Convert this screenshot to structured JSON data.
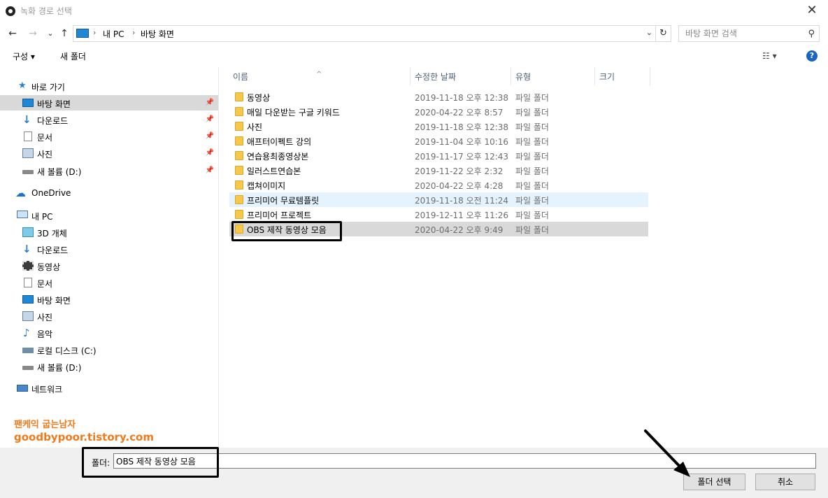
{
  "window": {
    "title": "녹화 경로 선택",
    "close_glyph": "✕"
  },
  "nav": {
    "back": "←",
    "forward": "→",
    "recent": "⌄",
    "up": "↑",
    "breadcrumb": [
      "내 PC",
      "바탕 화면"
    ],
    "refresh": "↻",
    "search_placeholder": "바탕 화면 검색"
  },
  "toolbar": {
    "organize": "구성 ▾",
    "new_folder": "새 폴더",
    "help": "?"
  },
  "sidebar": {
    "items": [
      {
        "label": "바로 가기",
        "icon": "star-icon"
      },
      {
        "label": "바탕 화면",
        "icon": "desktop-icon",
        "pinned": true,
        "selected": true
      },
      {
        "label": "다운로드",
        "icon": "download-icon",
        "pinned": true
      },
      {
        "label": "문서",
        "icon": "document-icon",
        "pinned": true
      },
      {
        "label": "사진",
        "icon": "pictures-icon",
        "pinned": true
      },
      {
        "label": "새 볼륨 (D:)",
        "icon": "drive-icon",
        "pinned": true
      },
      {
        "label": "OneDrive",
        "icon": "onedrive-icon"
      },
      {
        "label": "내 PC",
        "icon": "pc-icon"
      },
      {
        "label": "3D 개체",
        "icon": "3d-objects-icon"
      },
      {
        "label": "다운로드",
        "icon": "download-icon"
      },
      {
        "label": "동영상",
        "icon": "video-icon"
      },
      {
        "label": "문서",
        "icon": "document-icon"
      },
      {
        "label": "바탕 화면",
        "icon": "desktop-icon"
      },
      {
        "label": "사진",
        "icon": "pictures-icon"
      },
      {
        "label": "음악",
        "icon": "music-icon"
      },
      {
        "label": "로컬 디스크 (C:)",
        "icon": "local-disk-icon"
      },
      {
        "label": "새 볼륨 (D:)",
        "icon": "drive-icon"
      },
      {
        "label": "네트워크",
        "icon": "network-icon"
      }
    ],
    "watermark": {
      "line1": "팬케익 굽는남자",
      "line2": "goodbypoor.tistory.com"
    }
  },
  "filelist": {
    "columns": [
      "이름",
      "수정한 날짜",
      "유형",
      "크기"
    ],
    "rows": [
      {
        "name": "동영상",
        "date": "2019-11-18 오후 12:38",
        "type": "파일 폴더"
      },
      {
        "name": "매일 다운받는 구글 키워드",
        "date": "2020-04-22 오후 8:57",
        "type": "파일 폴더"
      },
      {
        "name": "사진",
        "date": "2019-11-18 오후 12:38",
        "type": "파일 폴더"
      },
      {
        "name": "애프터이펙트 강의",
        "date": "2019-11-04 오후 10:16",
        "type": "파일 폴더"
      },
      {
        "name": "연습용최종영상본",
        "date": "2019-11-17 오후 12:43",
        "type": "파일 폴더"
      },
      {
        "name": "일러스트연습본",
        "date": "2019-11-22 오후 2:32",
        "type": "파일 폴더"
      },
      {
        "name": "캡쳐이미지",
        "date": "2020-04-22 오후 4:28",
        "type": "파일 폴더"
      },
      {
        "name": "프리미어 무료템플릿",
        "date": "2019-11-18 오전 11:24",
        "type": "파일 폴더"
      },
      {
        "name": "프리미어 프로젝트",
        "date": "2019-12-11 오후 11:26",
        "type": "파일 폴더"
      },
      {
        "name": "OBS 제작 동영상 모음",
        "date": "2020-04-22 오후 9:49",
        "type": "파일 폴더"
      }
    ]
  },
  "footer": {
    "folder_label": "폴더:",
    "folder_value": "OBS 제작 동영상 모음",
    "select_button": "폴더 선택",
    "cancel_button": "취소"
  }
}
